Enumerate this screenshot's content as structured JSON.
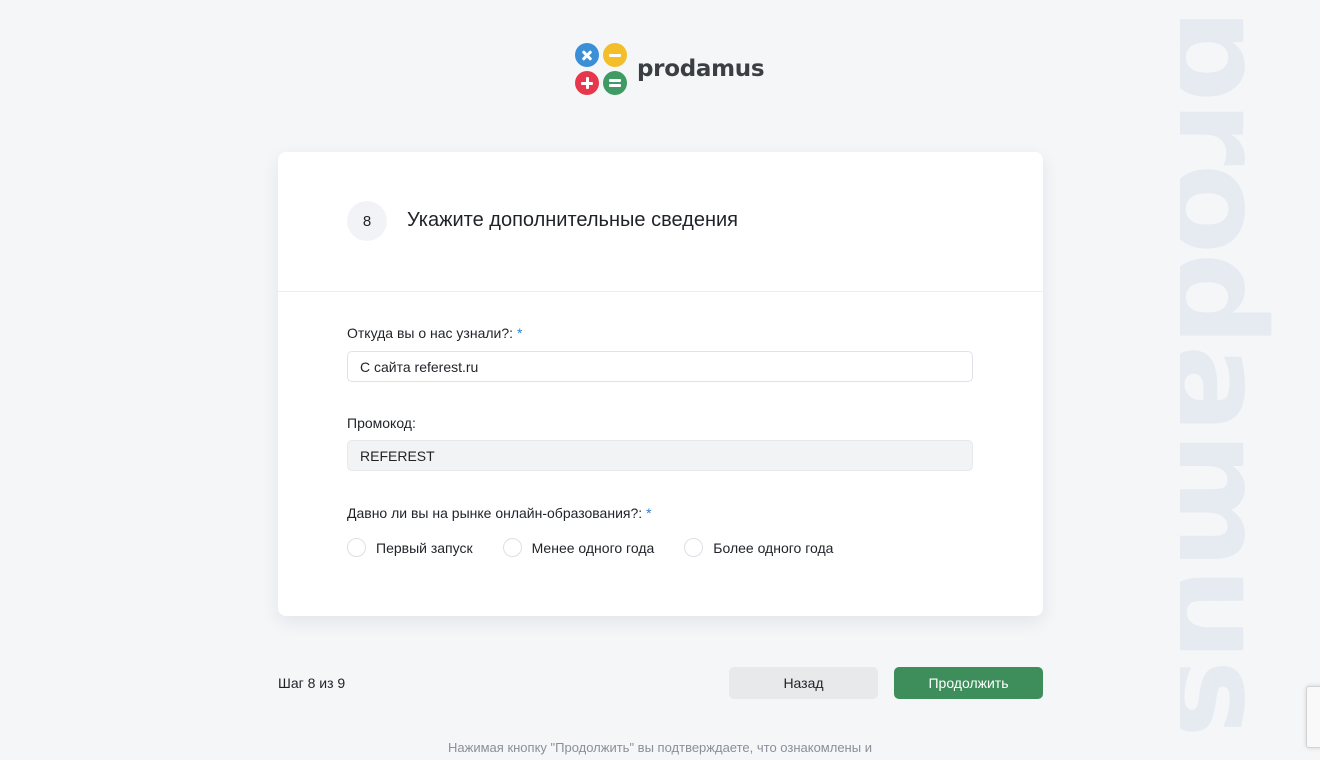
{
  "brand": {
    "name": "prodamus",
    "watermark": "prodamus"
  },
  "step": {
    "number": "8",
    "title": "Укажите дополнительные сведения",
    "counter": "Шаг 8 из 9"
  },
  "form": {
    "source": {
      "label": "Откуда вы о нас узнали?:",
      "required": "*",
      "value": "С сайта referest.ru"
    },
    "promo": {
      "label": "Промокод:",
      "value": "REFEREST"
    },
    "experience": {
      "label": "Давно ли вы на рынке онлайн-образования?:",
      "required": "*",
      "options": [
        "Первый запуск",
        "Менее одного года",
        "Более одного года"
      ]
    }
  },
  "buttons": {
    "back": "Назад",
    "continue": "Продолжить"
  },
  "footer": {
    "note": "Нажимая кнопку \"Продолжить\" вы подтверждаете, что ознакомлены и"
  },
  "colors": {
    "accent_green": "#3e8e5b",
    "required_blue": "#2f7fd1",
    "logo_blue": "#3a8fd6",
    "logo_yellow": "#f4bd2a",
    "logo_red": "#e7374c",
    "logo_green": "#3f9a63"
  },
  "icons": {
    "logo": [
      "multiply-icon",
      "minus-icon",
      "plus-icon",
      "equals-icon"
    ]
  }
}
